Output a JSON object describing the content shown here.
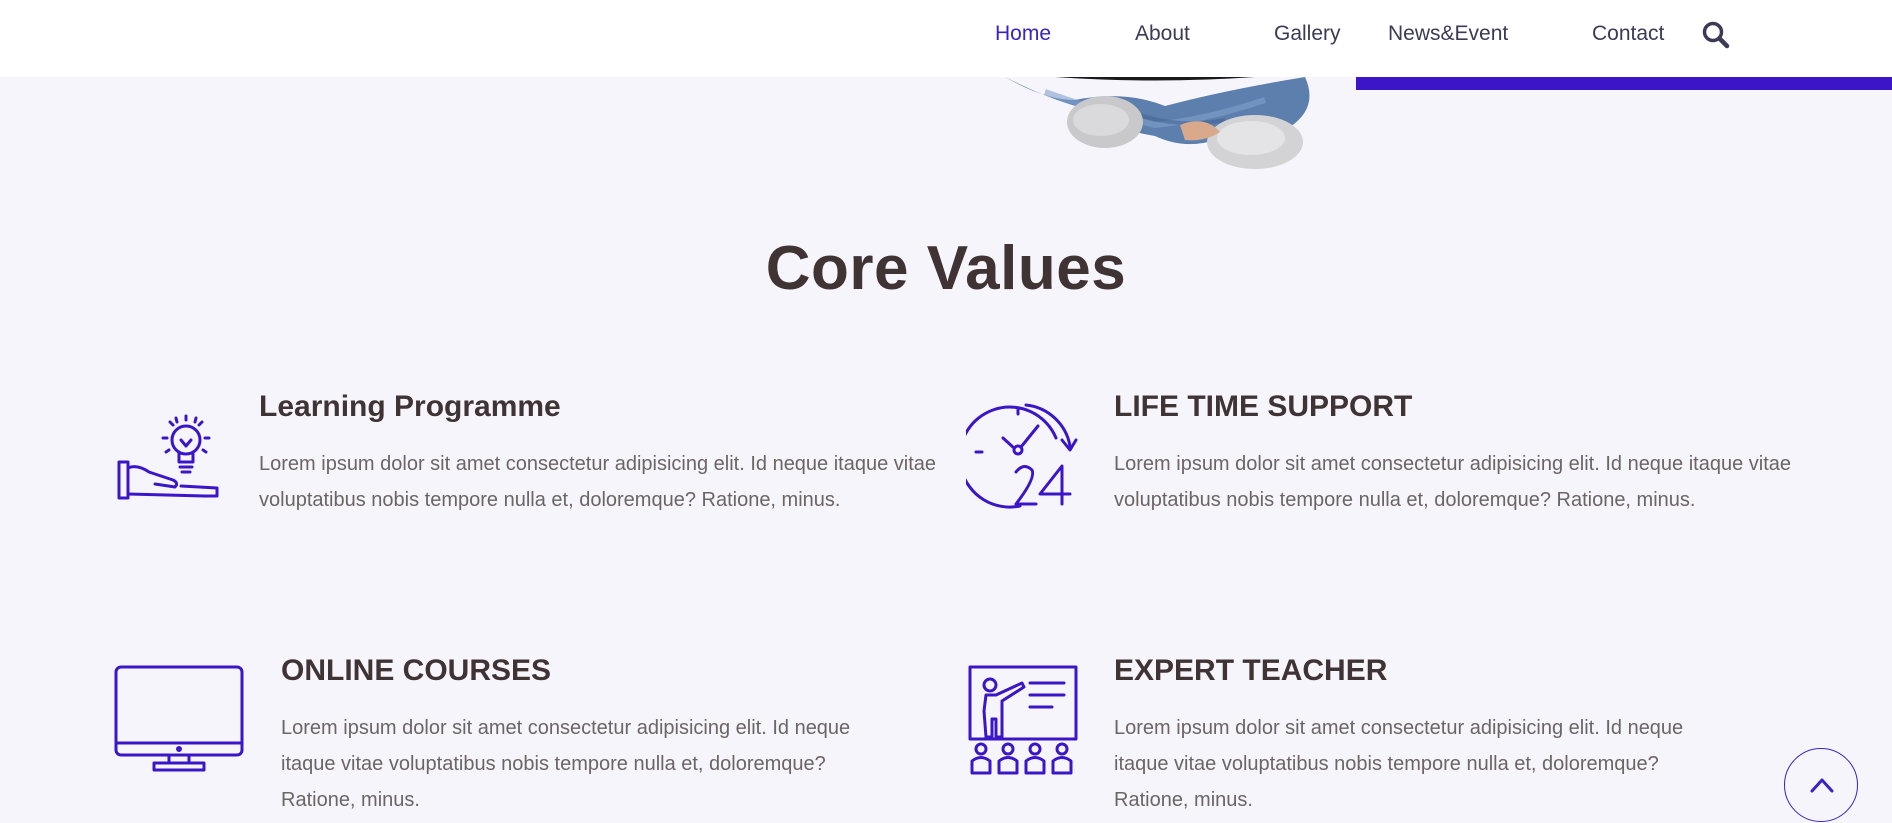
{
  "nav": {
    "items": [
      {
        "label": "Home",
        "active": true
      },
      {
        "label": "About"
      },
      {
        "label": "Gallery"
      },
      {
        "label": "News&Event"
      },
      {
        "label": "Contact"
      }
    ],
    "search_icon": "search-icon"
  },
  "colors": {
    "accent": "#3a22c4",
    "heading": "#3f3334",
    "body_text": "#6b6563",
    "background": "#f7f5fc"
  },
  "section": {
    "title": "Core Values",
    "cards": [
      {
        "icon": "hand-lightbulb-icon",
        "title": "Learning Programme",
        "text": "Lorem ipsum dolor sit amet consectetur adipisicing elit. Id neque itaque vitae voluptatibus nobis tempore nulla et, doloremque? Ratione, minus."
      },
      {
        "icon": "clock-24-icon",
        "title": "LIFE TIME SUPPORT",
        "text": "Lorem ipsum dolor sit amet consectetur adipisicing elit. Id neque itaque vitae voluptatibus nobis tempore nulla et, doloremque? Ratione, minus."
      },
      {
        "icon": "monitor-icon",
        "title": "ONLINE COURSES",
        "text": "Lorem ipsum dolor sit amet consectetur adipisicing elit. Id neque itaque vitae voluptatibus nobis tempore nulla et, doloremque? Ratione, minus."
      },
      {
        "icon": "teacher-presentation-icon",
        "title": "EXPERT TEACHER",
        "text": "Lorem ipsum dolor sit amet consectetur adipisicing elit. Id neque itaque vitae voluptatibus nobis tempore nulla et, doloremque? Ratione, minus."
      }
    ]
  },
  "back_to_top_icon": "chevron-up-icon"
}
